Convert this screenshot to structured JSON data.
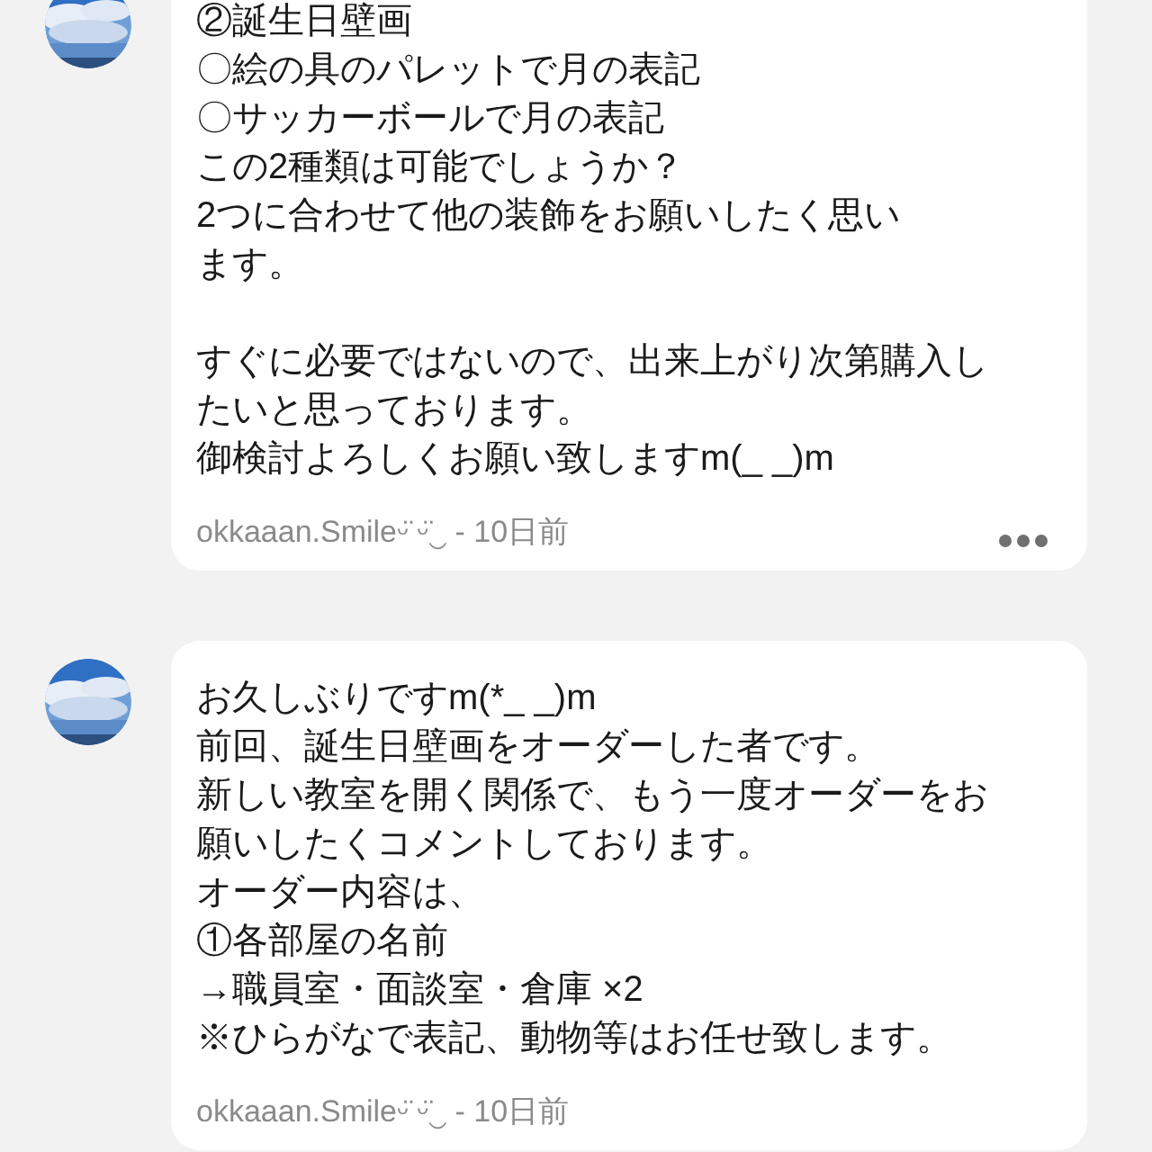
{
  "comments": [
    {
      "paragraphs": [
        [
          "②誕生日壁画",
          "〇絵の具のパレットで月の表記",
          "〇サッカーボールで月の表記",
          "この2種類は可能でしょうか？",
          "2つに合わせて他の装飾をお願いしたく思い",
          "ます。"
        ],
        [
          "すぐに必要ではないので、出来上がり次第購入し",
          "たいと思っております。",
          "御検討よろしくお願い致しますm(_ _)m"
        ]
      ],
      "meta": "okkaaan.Smileᵕ̈ ᵕ̈‿ - 10日前",
      "more_button": true
    },
    {
      "paragraphs": [
        [
          "お久しぶりですm(*_ _)m",
          "前回、誕生日壁画をオーダーした者です。",
          "新しい教室を開く関係で、もう一度オーダーをお",
          "願いしたくコメントしております。",
          "オーダー内容は、",
          "①各部屋の名前",
          "→職員室・面談室・倉庫 ×2",
          "※ひらがなで表記、動物等はお任せ致します。"
        ]
      ],
      "meta": "okkaaan.Smileᵕ̈ ᵕ̈‿ - 10日前",
      "more_button": false
    }
  ]
}
